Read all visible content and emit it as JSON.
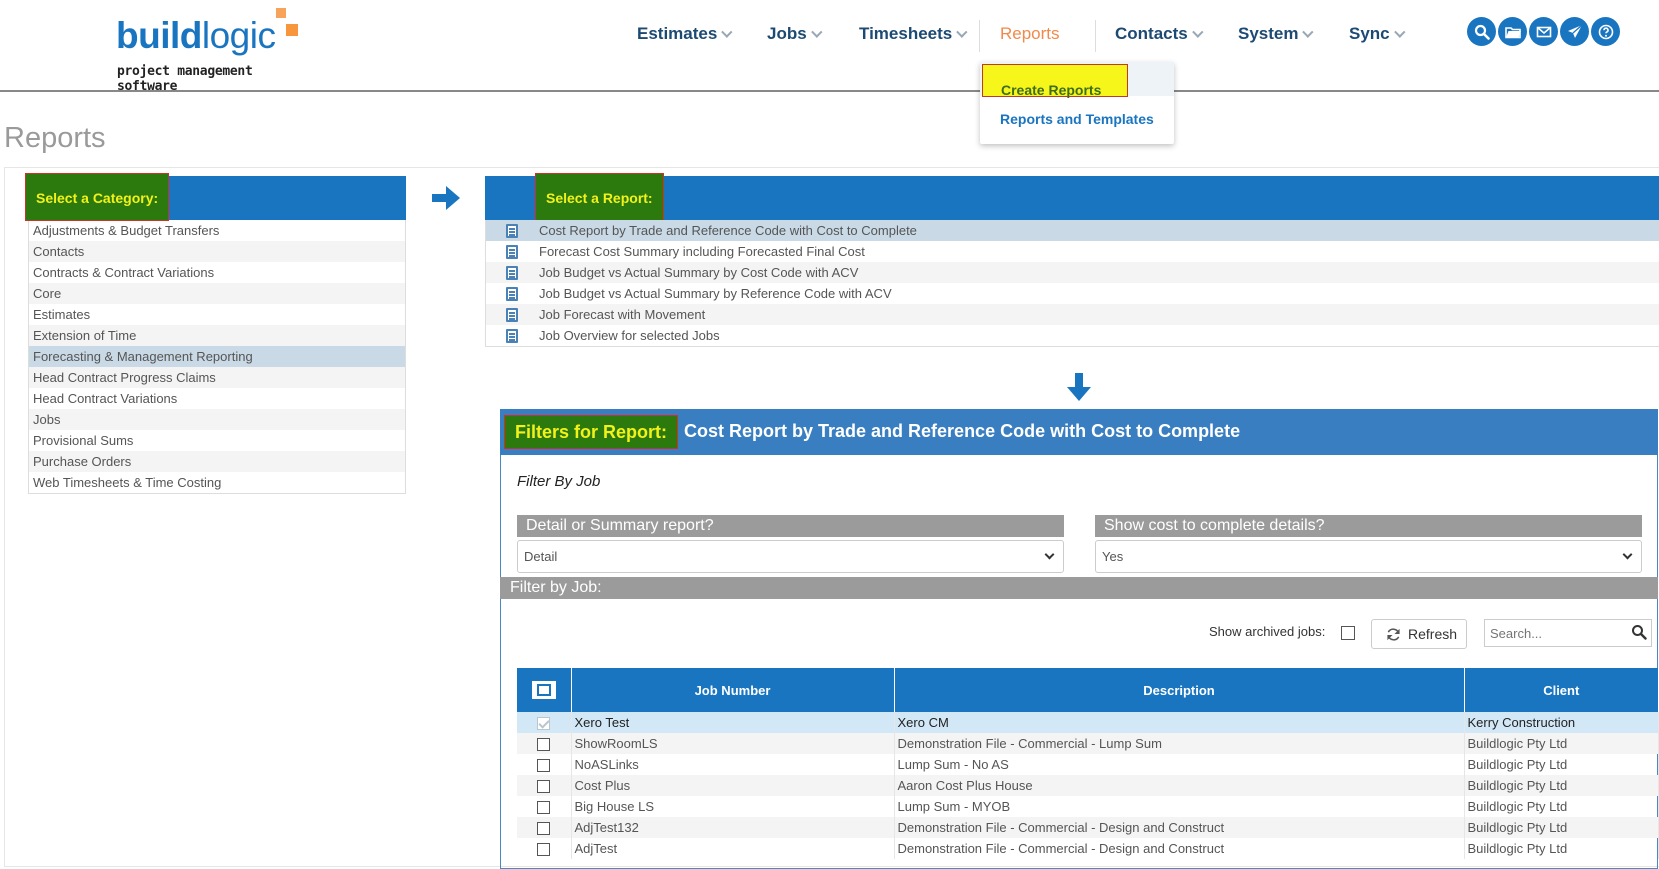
{
  "brand": {
    "name_bold": "build",
    "name_light": "logic",
    "tagline": "project management software",
    "accent": "#1a75c1",
    "orange": "#f7963c"
  },
  "nav": {
    "items": [
      {
        "label": "Estimates"
      },
      {
        "label": "Jobs"
      },
      {
        "label": "Timesheets"
      },
      {
        "label": "Reports"
      },
      {
        "label": "Contacts"
      },
      {
        "label": "System"
      },
      {
        "label": "Sync"
      }
    ],
    "icons": [
      "search-icon",
      "folder-icon",
      "mail-icon",
      "send-icon",
      "help-icon"
    ]
  },
  "reports_menu": {
    "items": [
      "Create Reports",
      "Reports and Templates"
    ]
  },
  "page": {
    "title": "Reports"
  },
  "category_panel": {
    "heading": "Select a Category:",
    "items": [
      "Adjustments & Budget Transfers",
      "Contacts",
      "Contracts & Contract Variations",
      "Core",
      "Estimates",
      "Extension of Time",
      "Forecasting & Management Reporting",
      "Head Contract Progress Claims",
      "Head Contract Variations",
      "Jobs",
      "Provisional Sums",
      "Purchase Orders",
      "Web Timesheets & Time Costing"
    ],
    "selected": "Forecasting & Management Reporting"
  },
  "report_panel": {
    "heading": "Select a Report:",
    "items": [
      "Cost Report by Trade and Reference Code with Cost to Complete",
      "Forecast Cost Summary including Forecasted Final Cost",
      "Job Budget vs Actual Summary by Cost Code with ACV",
      "Job Budget vs Actual Summary by Reference Code with ACV",
      "Job Forecast with Movement",
      "Job Overview for selected Jobs"
    ]
  },
  "filters": {
    "badge": "Filters for Report:",
    "report_title": "Cost Report by Trade and Reference Code with Cost to Complete",
    "filter_by_job_heading": "Filter By Job",
    "detail_label": "Detail or Summary report?",
    "detail_value": "Detail",
    "cost_label": "Show cost to complete details?",
    "cost_value": "Yes",
    "filter_by_job_bar": "Filter by Job:",
    "archived_label": "Show archived jobs:",
    "refresh_label": "Refresh",
    "search_placeholder": "Search..."
  },
  "jobs_table": {
    "columns": [
      "Job Number",
      "Description",
      "Client"
    ],
    "rows": [
      {
        "job": "Xero Test",
        "description": "Xero CM",
        "client": "Kerry Construction",
        "checked": true
      },
      {
        "job": "ShowRoomLS",
        "description": "Demonstration File - Commercial - Lump Sum",
        "client": "Buildlogic Pty Ltd",
        "checked": false
      },
      {
        "job": "NoASLinks",
        "description": "Lump Sum - No AS",
        "client": "Buildlogic Pty Ltd",
        "checked": false
      },
      {
        "job": "Cost Plus",
        "description": "Aaron Cost Plus House",
        "client": "Buildlogic Pty Ltd",
        "checked": false
      },
      {
        "job": "Big House LS",
        "description": "Lump Sum - MYOB",
        "client": "Buildlogic Pty Ltd",
        "checked": false
      },
      {
        "job": "AdjTest132",
        "description": "Demonstration File - Commercial - Design and Construct",
        "client": "Buildlogic Pty Ltd",
        "checked": false
      },
      {
        "job": "AdjTest",
        "description": "Demonstration File - Commercial - Design and Construct",
        "client": "Buildlogic Pty Ltd",
        "checked": false
      }
    ]
  }
}
